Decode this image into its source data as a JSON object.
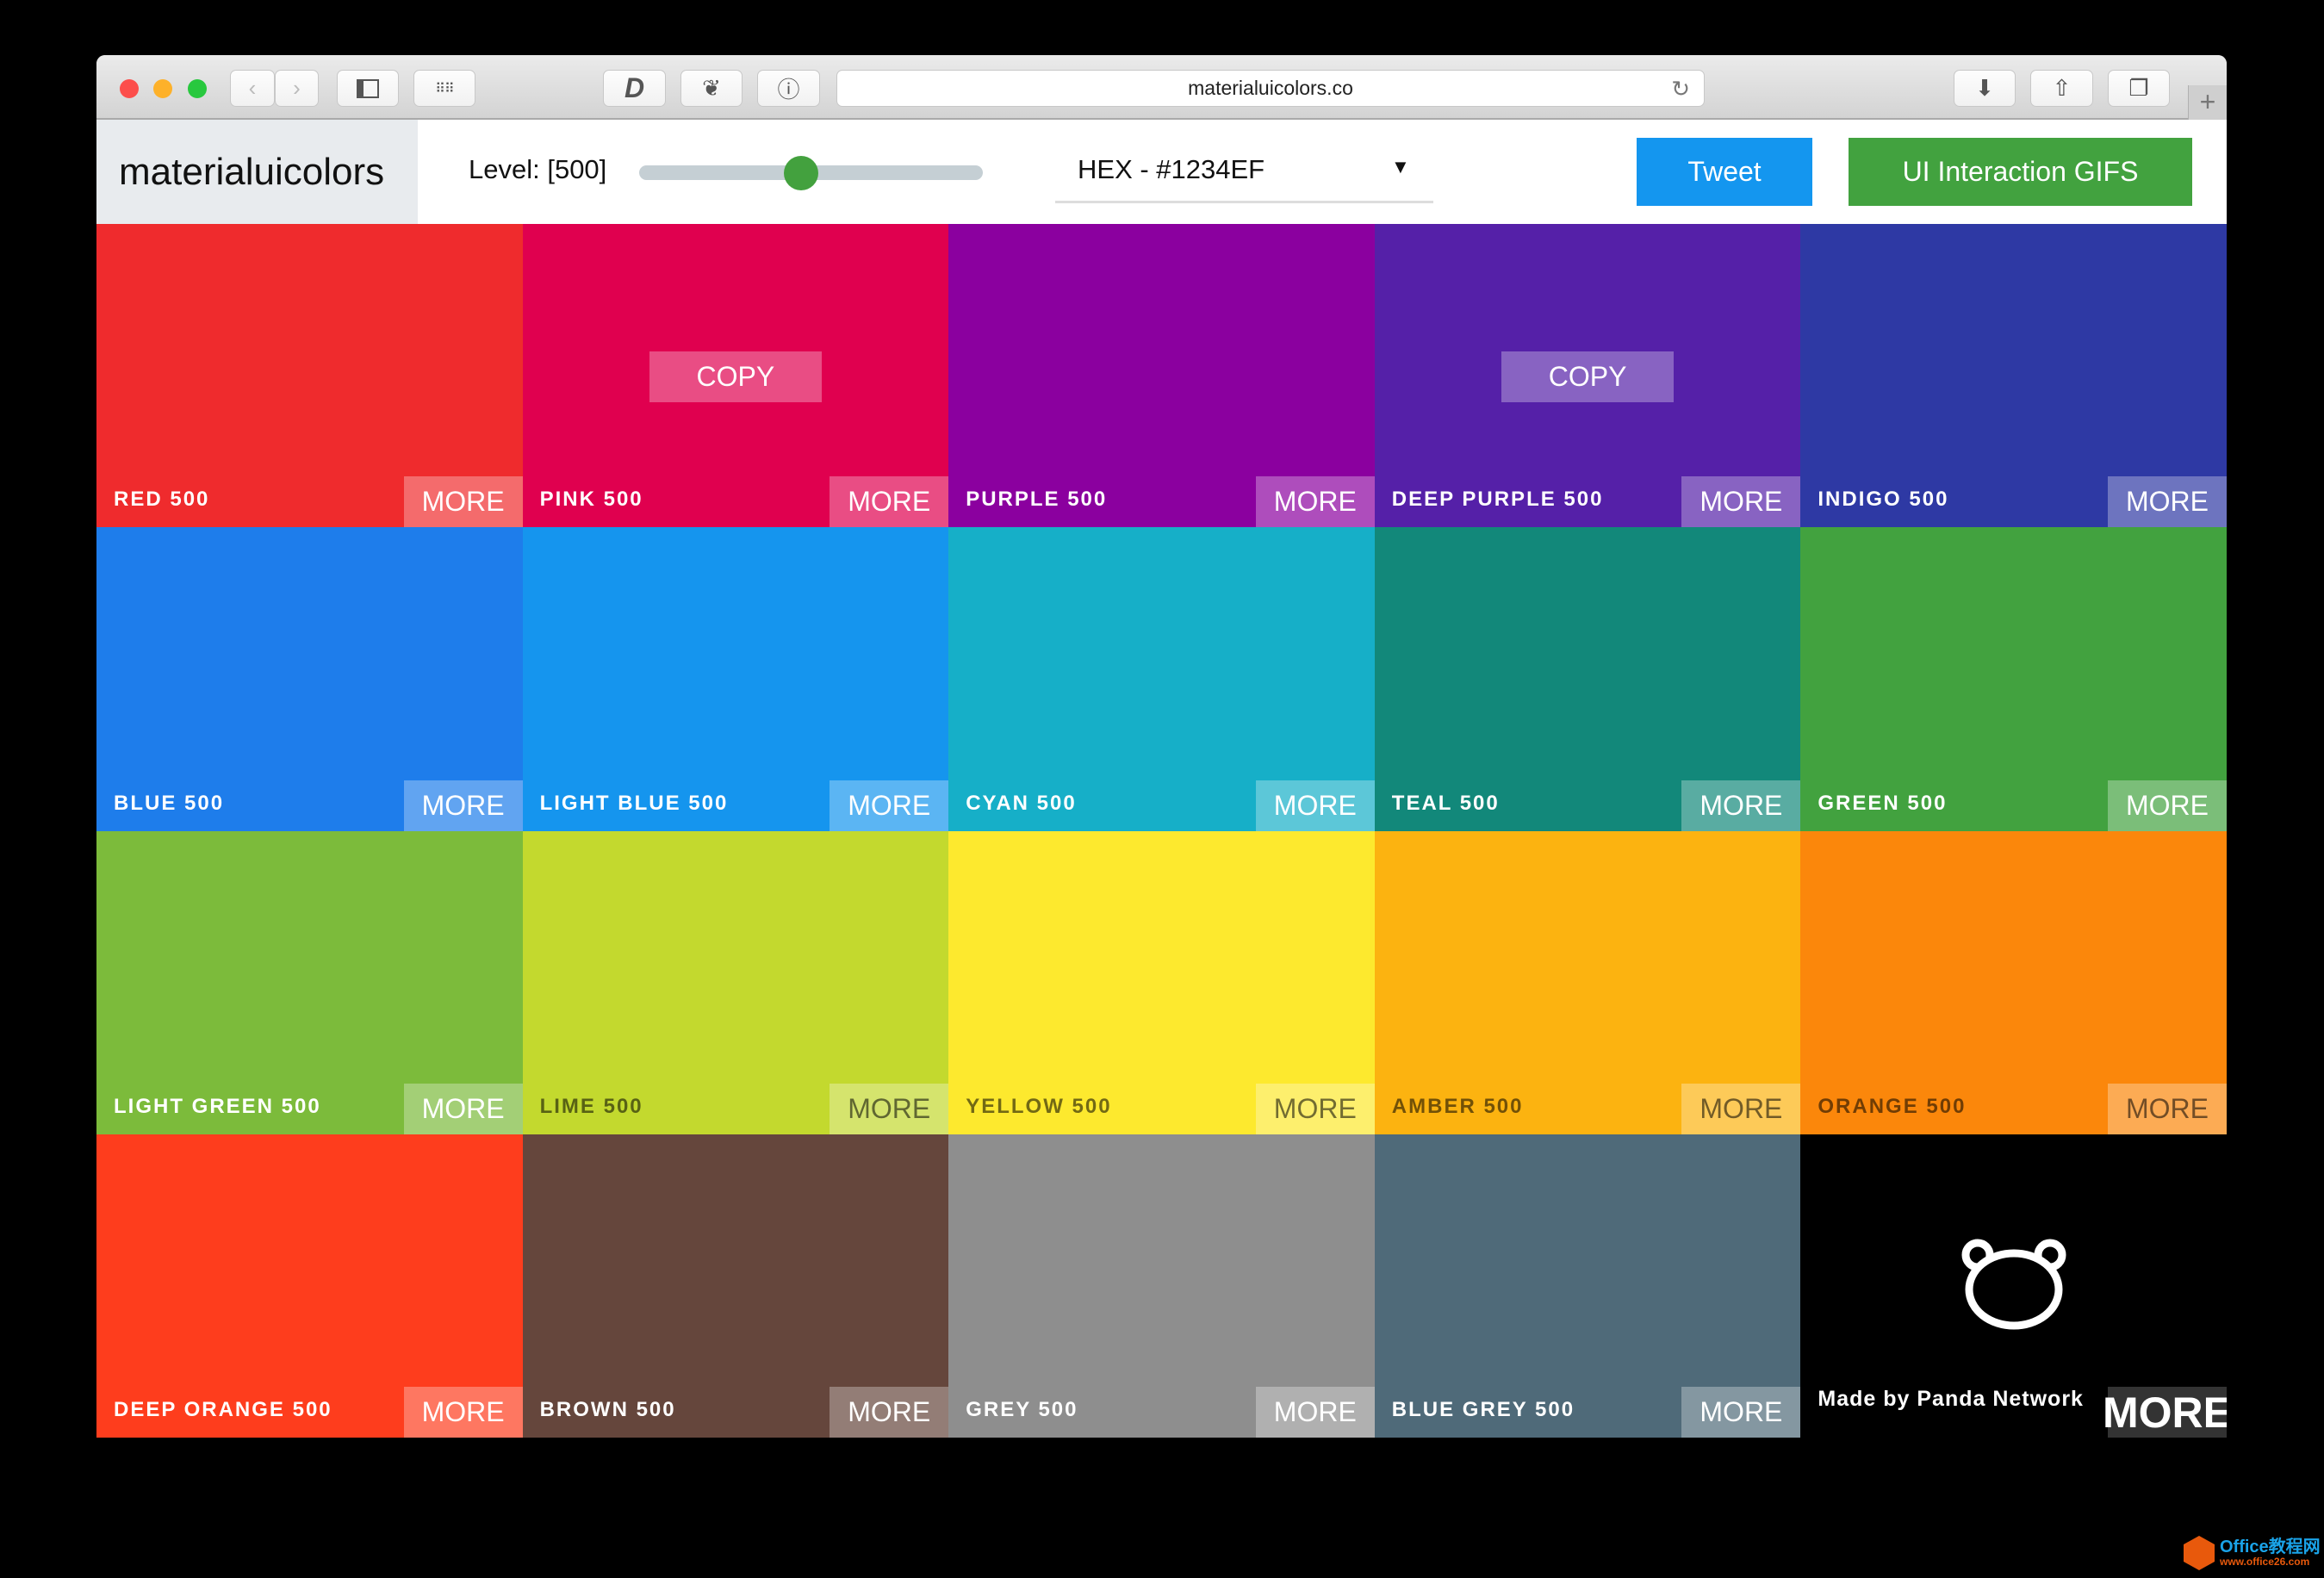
{
  "browser": {
    "url": "materialuicolors.co"
  },
  "header": {
    "logo": "materialuicolors",
    "level_label": "Level: [500]",
    "level_value": 500,
    "level_fraction": 0.47,
    "format_select": "HEX - #1234EF",
    "tweet": "Tweet",
    "gifs": "UI Interaction GIFS"
  },
  "copy_label": "COPY",
  "tiles": [
    {
      "name": "RED 500",
      "color": "#ef2b2d",
      "more": "MORE"
    },
    {
      "name": "PINK 500",
      "color": "#e0004f",
      "more": "MORE",
      "copy": true
    },
    {
      "name": "PURPLE 500",
      "color": "#8b009f",
      "more": "MORE"
    },
    {
      "name": "DEEP PURPLE 500",
      "color": "#5520a8",
      "more": "MORE",
      "copy": true
    },
    {
      "name": "INDIGO 500",
      "color": "#2e39a4",
      "more": "MORE"
    },
    {
      "name": "BLUE 500",
      "color": "#1e7deb",
      "more": "MORE"
    },
    {
      "name": "LIGHT BLUE 500",
      "color": "#1595ee",
      "more": "MORE"
    },
    {
      "name": "CYAN 500",
      "color": "#16afc8",
      "more": "MORE"
    },
    {
      "name": "TEAL 500",
      "color": "#12887a",
      "more": "MORE"
    },
    {
      "name": "GREEN 500",
      "color": "#42a23f",
      "more": "MORE"
    },
    {
      "name": "LIGHT GREEN 500",
      "color": "#7cbb3b",
      "more": "MORE"
    },
    {
      "name": "LIME 500",
      "color": "#c3d92e",
      "more": "MORE",
      "dark": true
    },
    {
      "name": "YELLOW 500",
      "color": "#fde92e",
      "more": "MORE",
      "dark": true
    },
    {
      "name": "AMBER 500",
      "color": "#fcb310",
      "more": "MORE",
      "dark": true
    },
    {
      "name": "ORANGE 500",
      "color": "#fb870b",
      "more": "MORE",
      "dark": true
    },
    {
      "name": "DEEP ORANGE 500",
      "color": "#fe3d1d",
      "more": "MORE"
    },
    {
      "name": "BROWN 500",
      "color": "#65463c",
      "more": "MORE"
    },
    {
      "name": "GREY 500",
      "color": "#8e8e8e",
      "more": "MORE"
    },
    {
      "name": "BLUE GREY 500",
      "color": "#4f6a79",
      "more": "MORE"
    }
  ],
  "panda": {
    "made_by": "Made by Panda Network",
    "more": "MORE"
  },
  "watermark": {
    "line1": "Office教程网",
    "line2": "www.office26.com"
  }
}
